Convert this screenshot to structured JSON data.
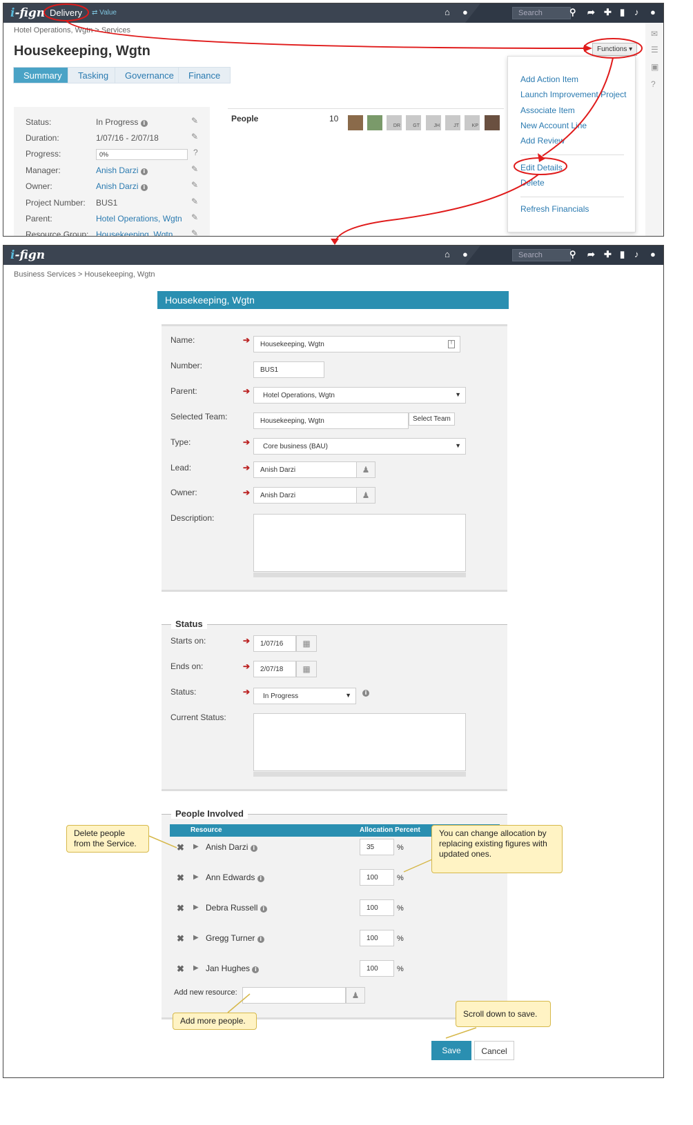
{
  "top": {
    "logo_i": "i",
    "logo_text": "-fign",
    "module": "Delivery",
    "switch": "⇄ Value",
    "search_placeholder": "Search",
    "breadcrumb": "Hotel Operations, Wgtn > Services",
    "title": "Housekeeping, Wgtn",
    "tabs": [
      "Summary",
      "Tasking",
      "Governance",
      "Finance"
    ],
    "functions_button": "Functions ▾",
    "details": [
      {
        "label": "Status:",
        "value": "In Progress"
      },
      {
        "label": "Duration:",
        "value": "1/07/16 - 2/07/18"
      },
      {
        "label": "Progress:",
        "value": "0%"
      },
      {
        "label": "Manager:",
        "value": "Anish Darzi"
      },
      {
        "label": "Owner:",
        "value": "Anish Darzi"
      },
      {
        "label": "Project Number:",
        "value": "BUS1"
      },
      {
        "label": "Parent:",
        "value": "Hotel Operations, Wgtn"
      },
      {
        "label": "Resource Group:",
        "value": "Housekeeping, Wgtn"
      }
    ],
    "people_label": "People",
    "people_count": "10",
    "avatars": [
      "",
      "",
      "DR",
      "GT",
      "JH",
      "JT",
      "KP",
      ""
    ],
    "menu_items": [
      "Add Action Item",
      "Launch Improvement Project",
      "Associate Item",
      "New Account Line",
      "Add Review",
      "Edit Details",
      "Delete",
      "Refresh Financials"
    ]
  },
  "bottom": {
    "breadcrumb": "Business Services > Housekeeping, Wgtn",
    "title": "Housekeeping, Wgtn",
    "fields": {
      "name_label": "Name:",
      "name_value": "Housekeeping, Wgtn",
      "number_label": "Number:",
      "number_value": "BUS1",
      "parent_label": "Parent:",
      "parent_value": "Hotel Operations, Wgtn",
      "team_label": "Selected Team:",
      "team_value": "Housekeeping, Wgtn",
      "select_team": "Select Team",
      "type_label": "Type:",
      "type_value": "Core business (BAU)",
      "lead_label": "Lead:",
      "lead_value": "Anish Darzi",
      "owner_label": "Owner:",
      "owner_value": "Anish Darzi",
      "description_label": "Description:"
    },
    "status_section": {
      "title": "Status",
      "starts_label": "Starts on:",
      "starts_value": "1/07/16",
      "ends_label": "Ends on:",
      "ends_value": "2/07/18",
      "status_label": "Status:",
      "status_value": "In Progress",
      "current_label": "Current Status:"
    },
    "people_section": {
      "title": "People Involved",
      "col_resource": "Resource",
      "col_alloc": "Allocation Percent",
      "rows": [
        {
          "name": "Anish Darzi",
          "alloc": "35"
        },
        {
          "name": "Ann Edwards",
          "alloc": "100"
        },
        {
          "name": "Debra Russell",
          "alloc": "100"
        },
        {
          "name": "Gregg Turner",
          "alloc": "100"
        },
        {
          "name": "Jan Hughes",
          "alloc": "100"
        }
      ],
      "pct_sign": "%",
      "add_label": "Add new resource:"
    },
    "save": "Save",
    "cancel": "Cancel"
  },
  "callouts": {
    "delete": "Delete people from the Service.",
    "allocation": "You can change allocation by replacing existing figures with updated ones.",
    "add": "Add more people.",
    "scroll": "Scroll down to save."
  },
  "colors": {
    "topbar": "#3b4451",
    "accent": "#2a8fb1",
    "link": "#2a7ab0",
    "annotation": "#e01b1b",
    "callout": "#fff3c4"
  }
}
